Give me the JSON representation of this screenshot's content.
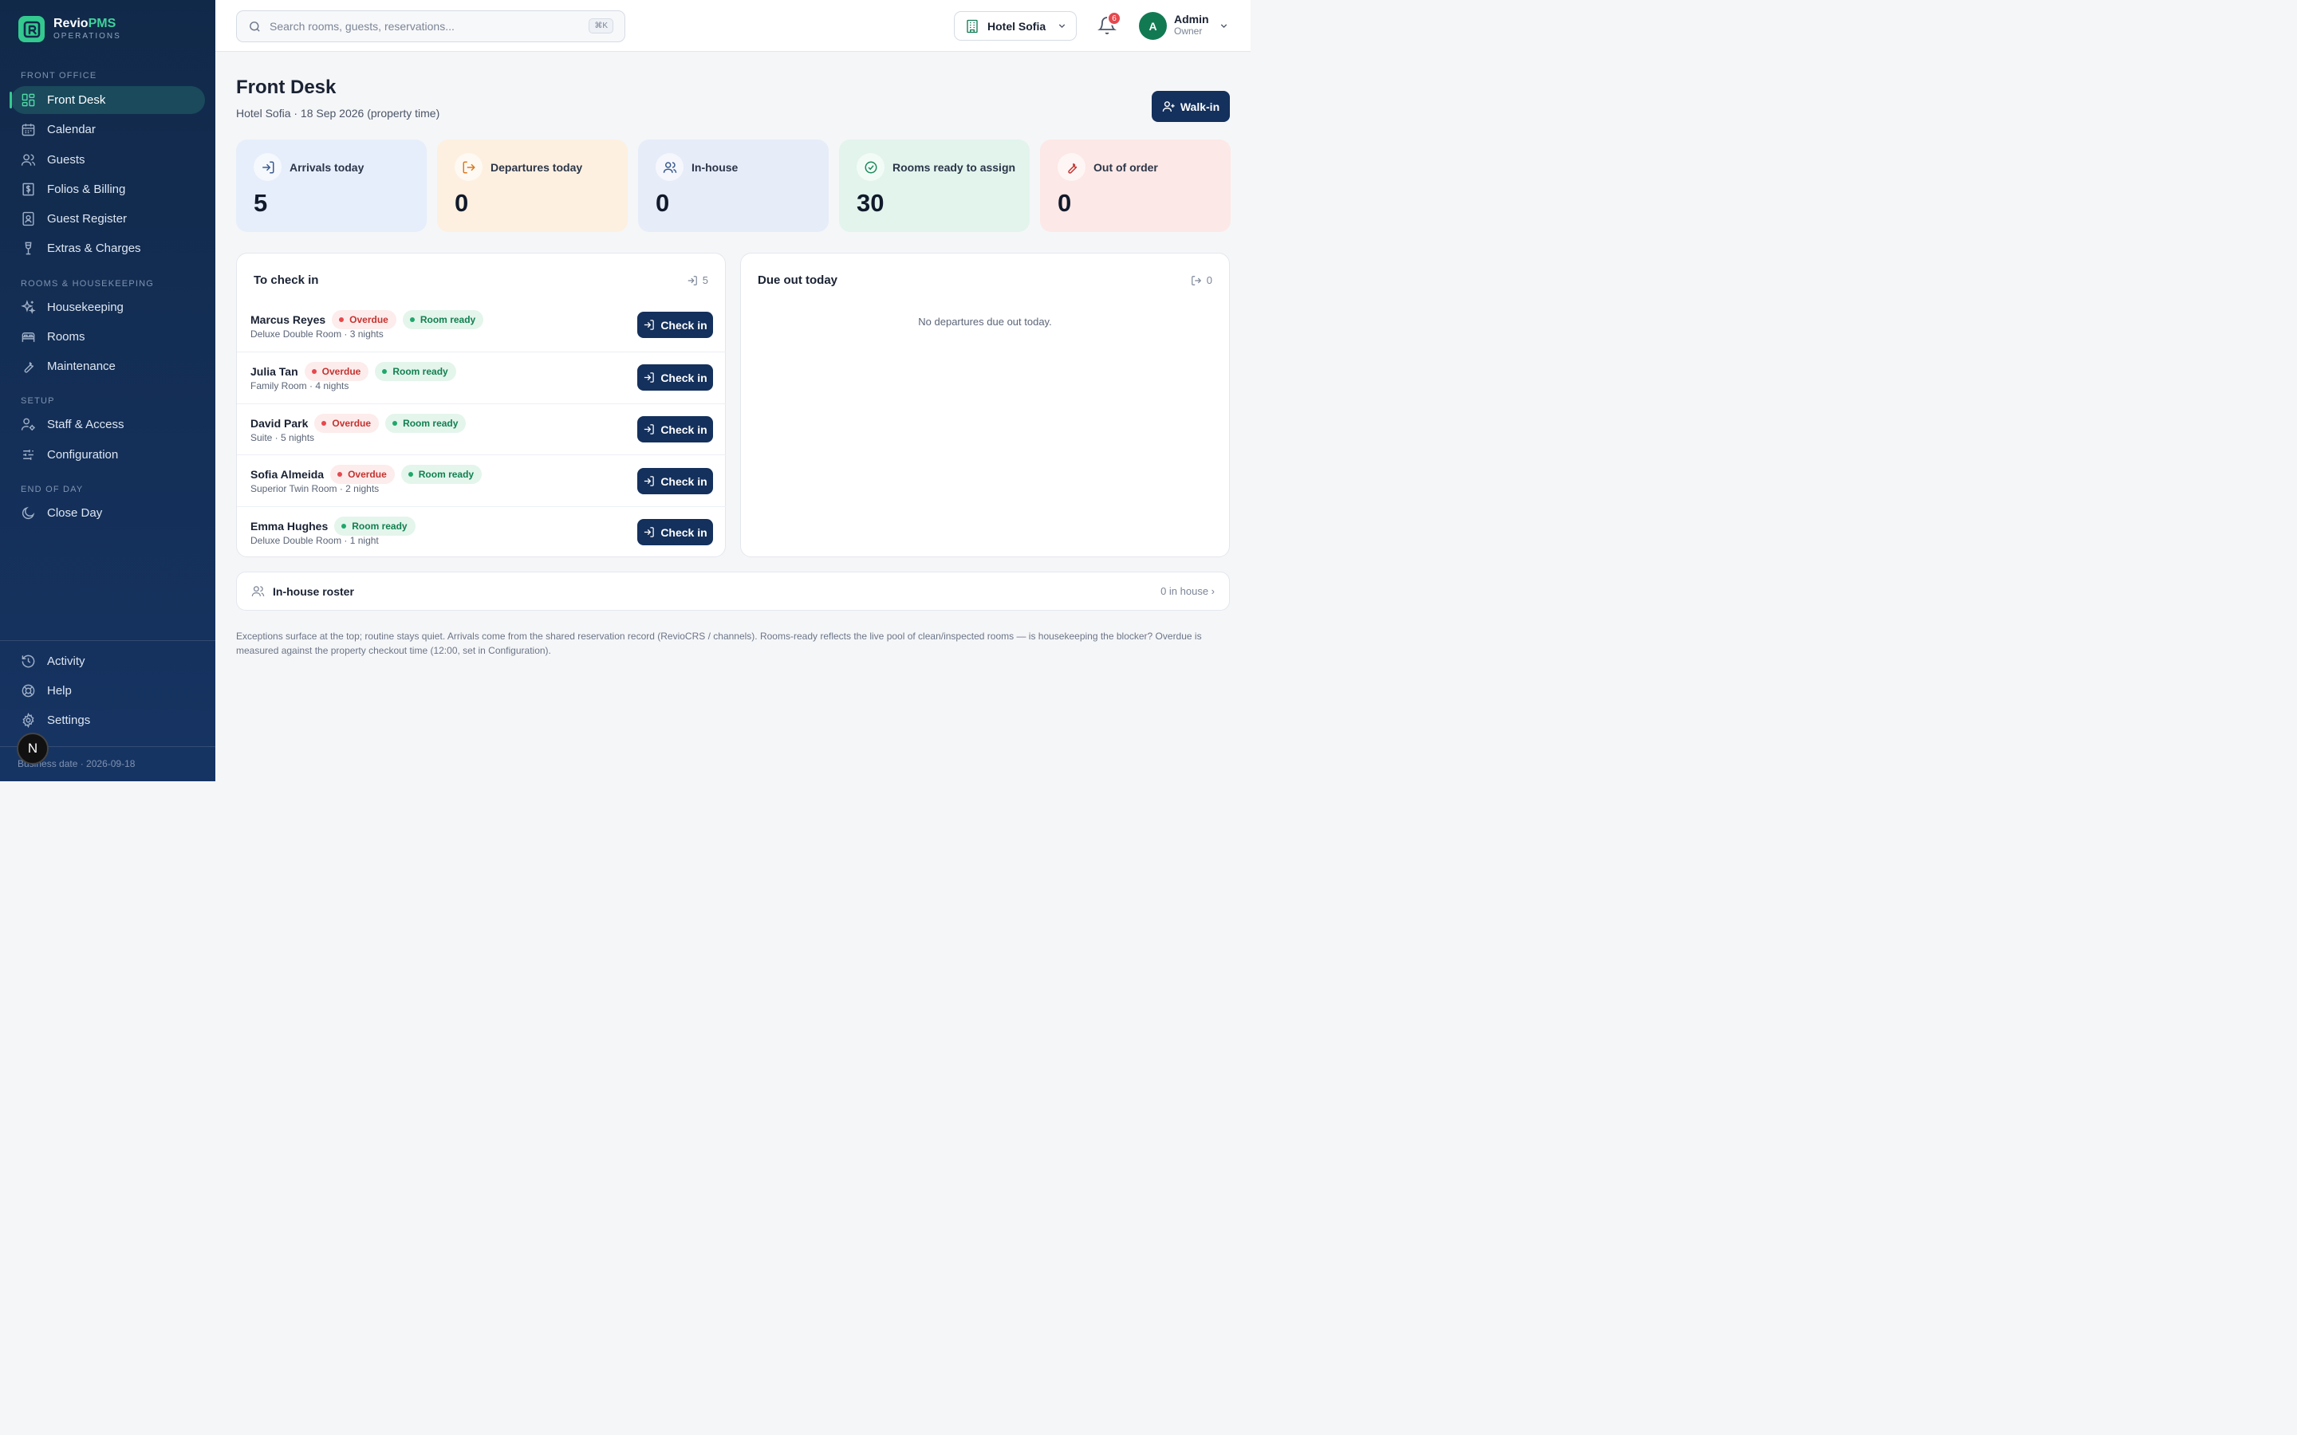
{
  "brand": {
    "name_a": "Revio",
    "name_b": "PMS",
    "sub": "OPERATIONS"
  },
  "sidebar": {
    "sections": {
      "front_office": "FRONT OFFICE",
      "rooms": "ROOMS & HOUSEKEEPING",
      "setup": "SETUP",
      "end_of_day": "END OF DAY"
    },
    "items": [
      {
        "label": "Front Desk",
        "icon": "grid-icon"
      },
      {
        "label": "Calendar",
        "icon": "calendar-icon"
      },
      {
        "label": "Guests",
        "icon": "users-icon"
      },
      {
        "label": "Folios & Billing",
        "icon": "receipt-icon"
      },
      {
        "label": "Guest Register",
        "icon": "register-icon"
      },
      {
        "label": "Extras & Charges",
        "icon": "wine-icon"
      },
      {
        "label": "Housekeeping",
        "icon": "sparkles-icon"
      },
      {
        "label": "Rooms",
        "icon": "bed-icon"
      },
      {
        "label": "Maintenance",
        "icon": "wrench-icon"
      },
      {
        "label": "Staff & Access",
        "icon": "user-cog-icon"
      },
      {
        "label": "Configuration",
        "icon": "sliders-icon"
      },
      {
        "label": "Close Day",
        "icon": "moon-icon"
      }
    ],
    "bottom": [
      {
        "label": "Activity",
        "icon": "history-icon"
      },
      {
        "label": "Help",
        "icon": "lifebuoy-icon"
      },
      {
        "label": "Settings",
        "icon": "gear-icon"
      }
    ],
    "business_date": "Business date · 2026-09-18",
    "fab": "N"
  },
  "topbar": {
    "search_placeholder": "Search rooms, guests, reservations...",
    "shortcut": "⌘K",
    "hotel": "Hotel Sofia",
    "notifications": "6",
    "user": {
      "initial": "A",
      "name": "Admin",
      "role": "Owner"
    }
  },
  "page": {
    "title": "Front Desk",
    "subtitle": "Hotel Sofia · 18 Sep 2026 (property time)",
    "walkin_label": "Walk-in"
  },
  "stats": [
    {
      "label": "Arrivals today",
      "value": "5",
      "bg": "#e6eefb",
      "accent": "#3a5a8f"
    },
    {
      "label": "Departures today",
      "value": "0",
      "bg": "#fdf0e0",
      "accent": "#d97a1f"
    },
    {
      "label": "In-house",
      "value": "0",
      "bg": "#e6ecf8",
      "accent": "#3a5a8f"
    },
    {
      "label": "Rooms ready to assign",
      "value": "30",
      "bg": "#e2f4ec",
      "accent": "#1a8a5a"
    },
    {
      "label": "Out of order",
      "value": "0",
      "bg": "#fce8e6",
      "accent": "#c4332f"
    }
  ],
  "checkin": {
    "title": "To check in",
    "count": "5",
    "button_label": "Check in",
    "overdue_label": "Overdue",
    "ready_label": "Room ready",
    "rows": [
      {
        "name": "Marcus Reyes",
        "meta": "Deluxe Double Room · 3 nights",
        "overdue": true
      },
      {
        "name": "Julia Tan",
        "meta": "Family Room · 4 nights",
        "overdue": true
      },
      {
        "name": "David Park",
        "meta": "Suite · 5 nights",
        "overdue": true
      },
      {
        "name": "Sofia Almeida",
        "meta": "Superior Twin Room · 2 nights",
        "overdue": true
      },
      {
        "name": "Emma Hughes",
        "meta": "Deluxe Double Room · 1 night",
        "overdue": false
      }
    ]
  },
  "dueout": {
    "title": "Due out today",
    "count": "0",
    "empty": "No departures due out today."
  },
  "roster": {
    "title": "In-house roster",
    "count": "0 in house ›"
  },
  "footnote": "Exceptions surface at the top; routine stays quiet. Arrivals come from the shared reservation record (RevioCRS / channels). Rooms-ready reflects the live pool of clean/inspected rooms — is housekeeping the blocker? Overdue is measured against the property checkout time (12:00, set in Configuration)."
}
